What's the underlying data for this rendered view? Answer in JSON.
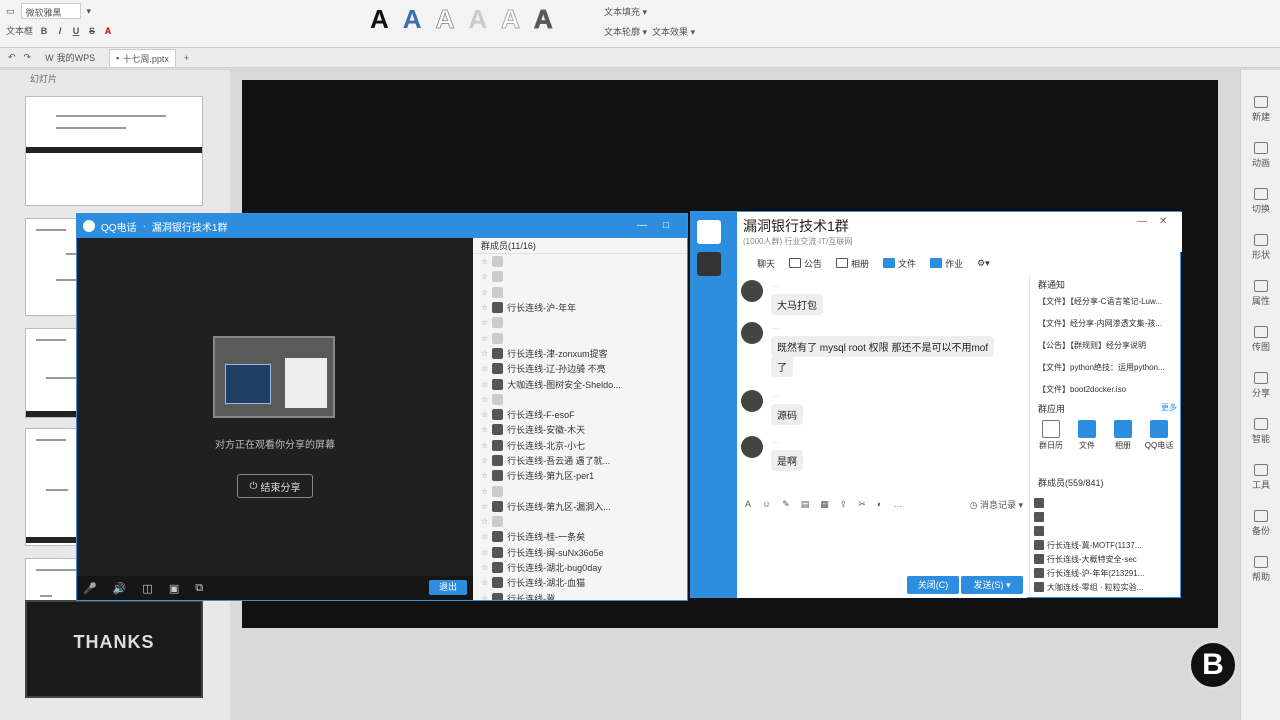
{
  "ribbon": {
    "font_name": "微软雅黑",
    "text_box": "文本框",
    "format_buttons": [
      "B",
      "I",
      "U",
      "S",
      "A"
    ],
    "wordart_samples": [
      "A",
      "A",
      "A",
      "A",
      "A",
      "A"
    ],
    "wordart_colors": [
      "#111111",
      "#3b6fb0",
      "#ffffff",
      "#cccccc",
      "#ffffff",
      "#555555"
    ],
    "text_fill": "文本填充",
    "text_outline": "文本轮廓",
    "text_effect": "文本效果"
  },
  "tabs": {
    "my_wps": "我的WPS",
    "doc": "十七周.pptx",
    "add": "+"
  },
  "thumbs": {
    "panel_tab": "幻灯片",
    "last_slide_title": "THANKS"
  },
  "call": {
    "title": "QQ电话",
    "group": "漏洞银行技术1群",
    "share_status": "对方正在观看你分享的屏幕",
    "stop_share": "结束分享",
    "exit": "退出",
    "members_header": "群成员(11/16)",
    "members": [
      {
        "name": "",
        "dim": true
      },
      {
        "name": "",
        "dim": true
      },
      {
        "name": "",
        "dim": true
      },
      {
        "name": "行长连线-沪-年年",
        "dim": false
      },
      {
        "name": "",
        "dim": true
      },
      {
        "name": "",
        "dim": true
      },
      {
        "name": "行长连线-津-zonxum提客",
        "dim": false
      },
      {
        "name": "行长连线-辽-孙边骑 不亮",
        "dim": false
      },
      {
        "name": "大咖连线-图树安全-Sheldo...",
        "dim": false
      },
      {
        "name": "",
        "dim": true
      },
      {
        "name": "行长连线-F-esoF",
        "dim": false
      },
      {
        "name": "行长连线-安徽-木天",
        "dim": false
      },
      {
        "name": "行长连线-北京-小七",
        "dim": false
      },
      {
        "name": "行长连线-吾云通 遇了就...",
        "dim": false
      },
      {
        "name": "行长连线-第九区-per1",
        "dim": false
      },
      {
        "name": "",
        "dim": true
      },
      {
        "name": "行长连线-第九区-漏洞入...",
        "dim": false
      },
      {
        "name": "",
        "dim": true
      },
      {
        "name": "行长连线-桂-一条矣",
        "dim": false
      },
      {
        "name": "行长连线-闽-suNx36o5e",
        "dim": false
      },
      {
        "name": "行长连线-湖北-bug0day",
        "dim": false
      },
      {
        "name": "行长连线-湖北-血猫",
        "dim": false
      },
      {
        "name": "行长连线-冀",
        "dim": false
      }
    ]
  },
  "chat": {
    "title": "漏洞银行技术1群",
    "subtitle": "(1000人群) 行业交流-IT/互联网",
    "tools": [
      "聊天",
      "公告",
      "相册",
      "文件",
      "作业"
    ],
    "messages": [
      {
        "text": "大马打包"
      },
      {
        "text": "既然有了 mysql root 权限 那还不是可以不用mof"
      },
      {
        "text": "了"
      },
      {
        "text": "源码"
      },
      {
        "text": "是啊"
      }
    ],
    "history": "消息记录",
    "close_label": "关闭(C)",
    "send_label": "发送(S)",
    "notice_title": "群通知",
    "notices": [
      "【文件】【经分享-C语言笔记-Luw...",
      "【文件】经分享-内网渗透文集-孩...",
      "【公告】【群规则】经分享说明",
      "【文件】python绝技：运用python...",
      "【文件】boot2docker.iso"
    ],
    "apps_title": "群应用",
    "apps_more": "更多",
    "apps": [
      "群日历",
      "文件",
      "相册",
      "QQ电话"
    ],
    "group_members_title": "群成员(559/841)",
    "group_members": [
      "",
      "",
      "",
      "行长连线-冀-MOTF(1137...",
      "行长连线-大概特安全-sec",
      "行长连线-沪-年年(213291...",
      "大咖连线-零组 · 粒粒实验..."
    ]
  },
  "rail": [
    "新建",
    "动画",
    "切换",
    "形状",
    "属性",
    "传图",
    "分享",
    "智能",
    "工具",
    "备份",
    "帮助"
  ]
}
